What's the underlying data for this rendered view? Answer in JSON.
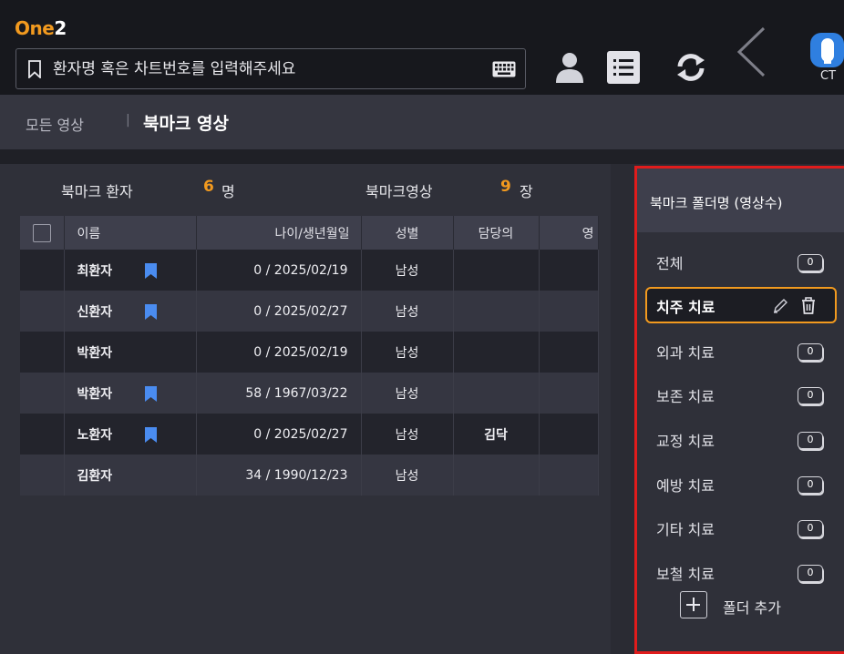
{
  "app": {
    "logo_main": "One",
    "logo_suffix": "2"
  },
  "search": {
    "placeholder": "환자명 혹은 차트번호를 입력해주세요"
  },
  "toolbar": {
    "user_label": "CT"
  },
  "breadcrumb": {
    "parent": "모든 영상",
    "separator": "|",
    "current": "북마크 영상"
  },
  "stats": {
    "patients_label": "북마크 환자",
    "patients_count": "6",
    "patients_unit": "명",
    "images_label": "북마크영상",
    "images_count": "9",
    "images_unit": "장"
  },
  "table": {
    "columns": [
      "이름",
      "나이/생년월일",
      "성별",
      "담당의",
      "영"
    ],
    "rows": [
      {
        "name": "최환자",
        "bookmarked": true,
        "age_dob": "0 / 2025/02/19",
        "sex": "남성",
        "doctor": ""
      },
      {
        "name": "신환자",
        "bookmarked": true,
        "age_dob": "0 / 2025/02/27",
        "sex": "남성",
        "doctor": ""
      },
      {
        "name": "박환자",
        "bookmarked": false,
        "age_dob": "0 / 2025/02/19",
        "sex": "남성",
        "doctor": ""
      },
      {
        "name": "박환자",
        "bookmarked": true,
        "age_dob": "58 / 1967/03/22",
        "sex": "남성",
        "doctor": ""
      },
      {
        "name": "노환자",
        "bookmarked": true,
        "age_dob": "0 / 2025/02/27",
        "sex": "남성",
        "doctor": "김닥"
      },
      {
        "name": "김환자",
        "bookmarked": false,
        "age_dob": "34 / 1990/12/23",
        "sex": "남성",
        "doctor": ""
      }
    ]
  },
  "folders": {
    "header": "북마크 폴더명 (영상수)",
    "items": [
      {
        "label": "전체",
        "count": "0"
      },
      {
        "label": "치주 치료",
        "count": ""
      },
      {
        "label": "외과 치료",
        "count": "0"
      },
      {
        "label": "보존 치료",
        "count": "0"
      },
      {
        "label": "교정 치료",
        "count": "0"
      },
      {
        "label": "예방 치료",
        "count": "0"
      },
      {
        "label": "기타 치료",
        "count": "0"
      },
      {
        "label": "보철 치료",
        "count": "0"
      }
    ],
    "add_label": "폴더 추가"
  },
  "colors": {
    "accent": "#f29a1f",
    "highlight_border": "#e01c1c",
    "bookmark_blue": "#4a8cf0"
  }
}
